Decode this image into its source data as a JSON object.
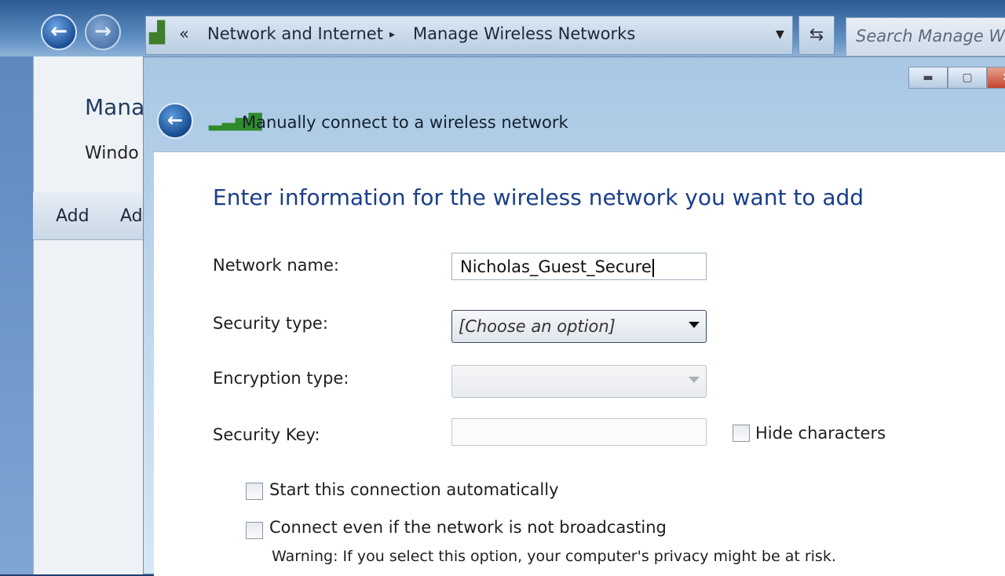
{
  "explorer": {
    "breadcrumb_prefix": "«",
    "breadcrumb_1": "Network and Internet",
    "breadcrumb_sep": "▸",
    "breadcrumb_2": "Manage Wireless Networks",
    "search_placeholder": "Search Manage Wir",
    "page_title": "Mana",
    "page_subtitle": "Windo",
    "toolbar_add": "Add",
    "toolbar_partial": "Ad",
    "back_icon": "back-arrow-icon",
    "forward_icon": "forward-arrow-icon"
  },
  "dialog": {
    "title": "Manually connect to a wireless network",
    "heading": "Enter information for the wireless network you want to add",
    "window_buttons": {
      "minimize": "▬",
      "maximize": "▢",
      "close": "✕"
    },
    "fields": {
      "network_name_label": "Network name:",
      "network_name_value": "Nicholas_Guest_Secure",
      "security_type_label": "Security type:",
      "security_type_value": "[Choose an option]",
      "encryption_type_label": "Encryption type:",
      "encryption_type_value": "",
      "security_key_label": "Security Key:",
      "security_key_value": ""
    },
    "checkboxes": {
      "hide_characters": "Hide characters",
      "start_automatically": "Start this connection automatically",
      "connect_not_broadcasting": "Connect even if the network is not broadcasting"
    },
    "warning": "Warning: If you select this option, your computer's privacy might be at risk."
  }
}
